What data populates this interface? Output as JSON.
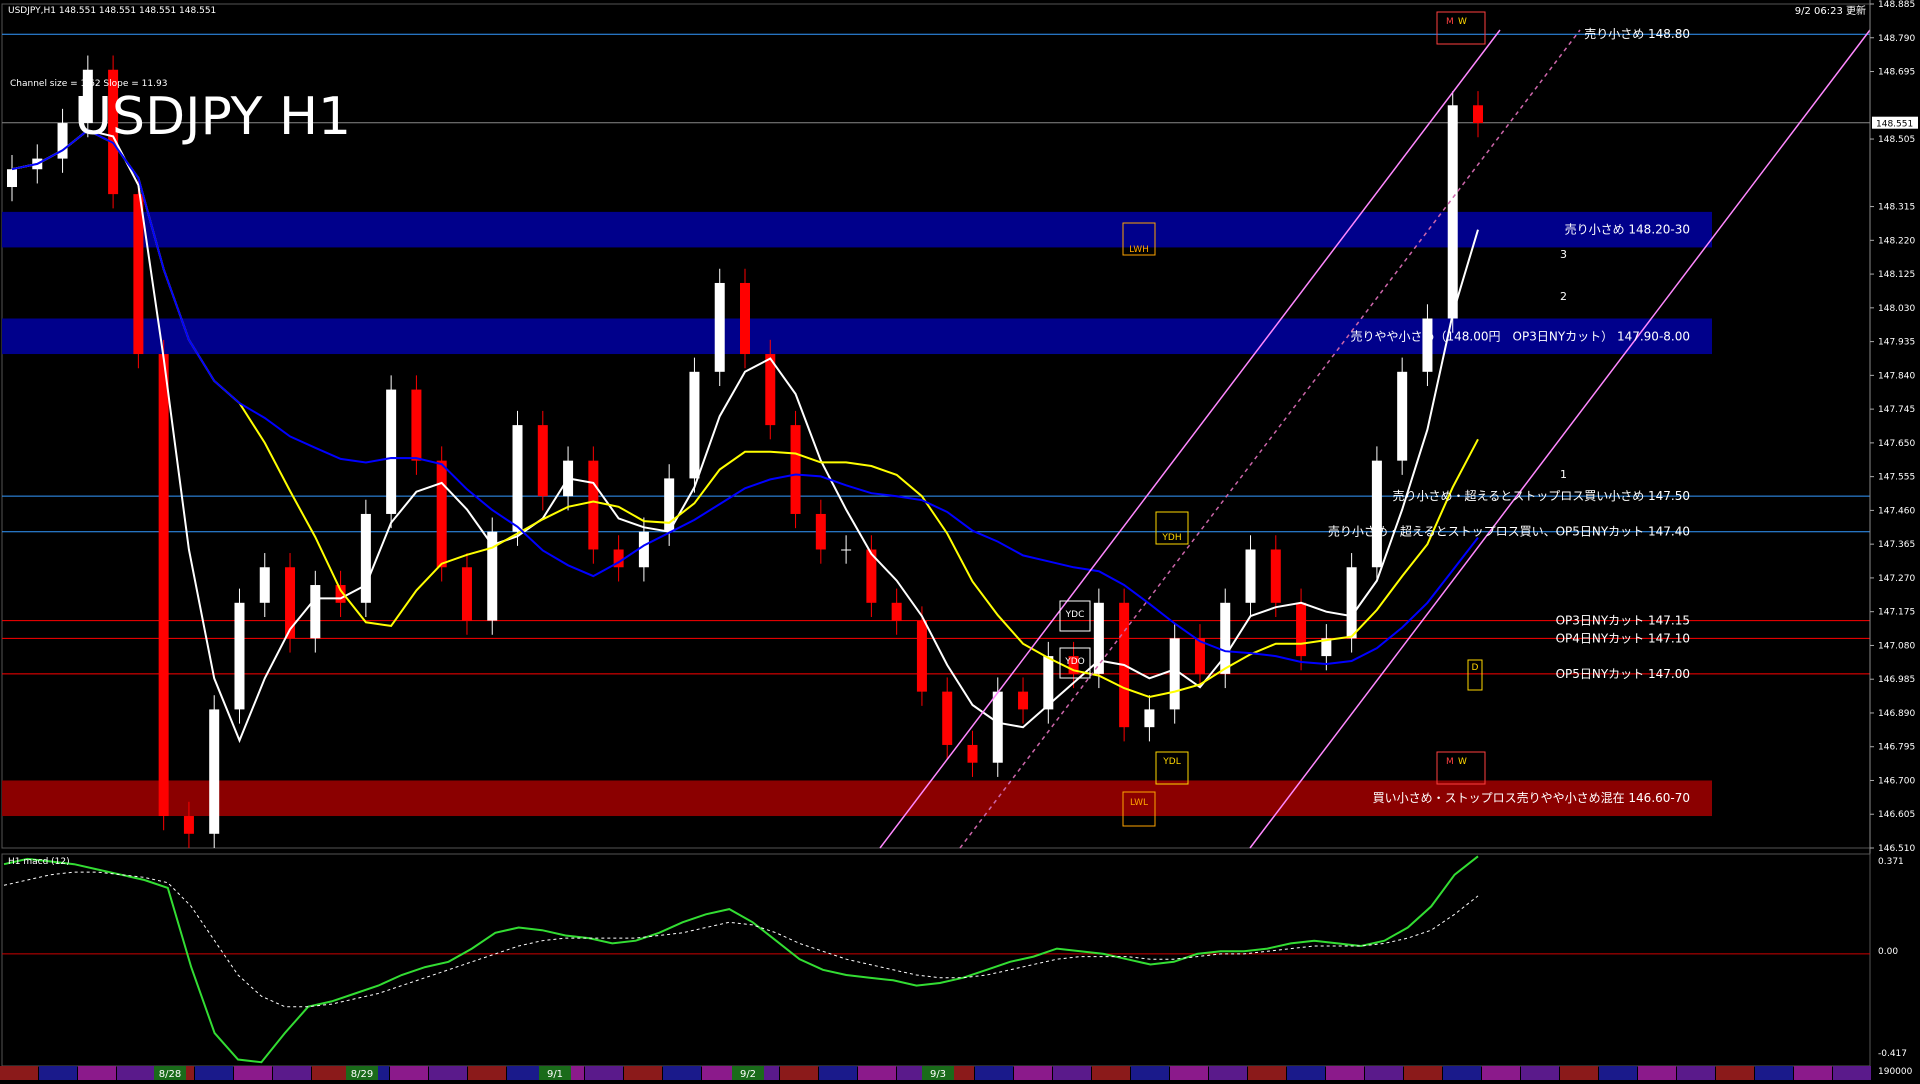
{
  "header": {
    "symbol_line": "USDJPY,H1  148.551 148.551 148.551 148.551",
    "channel_info": "Channel size = 1.62  Slope = 11.93",
    "big_title": "USDJPY H1",
    "datetime": "9/2 06:23 更新"
  },
  "price_axis": {
    "min": 146.51,
    "max": 148.885,
    "ticks": [
      "148.885",
      "148.790",
      "148.695",
      "148.505",
      "148.315",
      "148.220",
      "148.125",
      "148.030",
      "147.935",
      "147.840",
      "147.745",
      "147.650",
      "147.555",
      "147.460",
      "147.365",
      "147.270",
      "147.175",
      "147.080",
      "146.985",
      "146.890",
      "146.795",
      "146.700",
      "146.605",
      "146.510"
    ],
    "current": "148.551"
  },
  "macd": {
    "label": "H1  macd (12)",
    "axis_top": "0.371",
    "axis_zero": "0.00",
    "axis_bottom": "-0.417",
    "axis_footer": "190000",
    "range": [
      -0.417,
      0.371
    ],
    "main": [
      0.34,
      0.36,
      0.35,
      0.34,
      0.32,
      0.3,
      0.28,
      0.25,
      -0.05,
      -0.3,
      -0.4,
      -0.41,
      -0.3,
      -0.2,
      -0.18,
      -0.15,
      -0.12,
      -0.08,
      -0.05,
      -0.03,
      0.02,
      0.08,
      0.1,
      0.09,
      0.07,
      0.06,
      0.04,
      0.05,
      0.08,
      0.12,
      0.15,
      0.17,
      0.12,
      0.05,
      -0.02,
      -0.06,
      -0.08,
      -0.09,
      -0.1,
      -0.12,
      -0.11,
      -0.09,
      -0.06,
      -0.03,
      -0.01,
      0.02,
      0.01,
      0.0,
      -0.02,
      -0.04,
      -0.03,
      0.0,
      0.01,
      0.01,
      0.02,
      0.04,
      0.05,
      0.04,
      0.03,
      0.05,
      0.1,
      0.18,
      0.3,
      0.37
    ],
    "signal": [
      0.26,
      0.28,
      0.3,
      0.31,
      0.31,
      0.3,
      0.29,
      0.27,
      0.18,
      0.05,
      -0.08,
      -0.16,
      -0.2,
      -0.2,
      -0.19,
      -0.17,
      -0.15,
      -0.12,
      -0.09,
      -0.06,
      -0.03,
      0.0,
      0.03,
      0.05,
      0.06,
      0.06,
      0.06,
      0.06,
      0.07,
      0.08,
      0.1,
      0.12,
      0.11,
      0.08,
      0.04,
      0.01,
      -0.02,
      -0.04,
      -0.06,
      -0.08,
      -0.09,
      -0.09,
      -0.08,
      -0.06,
      -0.04,
      -0.02,
      -0.01,
      -0.01,
      -0.01,
      -0.02,
      -0.02,
      -0.01,
      0.0,
      0.0,
      0.01,
      0.02,
      0.03,
      0.03,
      0.03,
      0.04,
      0.06,
      0.09,
      0.15,
      0.22
    ]
  },
  "dates": [
    "8/28",
    "8/29",
    "9/1",
    "9/2",
    "9/3"
  ],
  "zones": [
    {
      "label": "売り小さめ 148.20-30",
      "from": 148.2,
      "to": 148.3,
      "color": "#00008b"
    },
    {
      "label": "売りやや小さめ（148.00円　OP3日NYカット） 147.90-8.00",
      "from": 147.9,
      "to": 148.0,
      "color": "#00008b"
    },
    {
      "label": "買い小さめ・ストップロス売りやや小さめ混在 146.60-70",
      "from": 146.6,
      "to": 146.7,
      "color": "#8b0000"
    }
  ],
  "levels": [
    {
      "label": "売り小さめ 148.80",
      "price": 148.8,
      "color": "#3399ff"
    },
    {
      "label": "売り小さめ・超えるとストップロス買い小さめ 147.50",
      "price": 147.5,
      "color": "#3399ff"
    },
    {
      "label": "売り小さめ・超えるとストップロス買い、OP5日NYカット 147.40",
      "price": 147.4,
      "color": "#3399ff"
    },
    {
      "label": "OP3日NYカット 147.15",
      "price": 147.15,
      "color": "#ff0000"
    },
    {
      "label": "OP4日NYカット 147.10",
      "price": 147.1,
      "color": "#ff0000"
    },
    {
      "label": "OP5日NYカット 147.00",
      "price": 147.0,
      "color": "#ff0000"
    }
  ],
  "boxes": {
    "lwh": "LWH",
    "lwl": "LWL",
    "ydh": "YDH",
    "ydl": "YDL",
    "ydc": "YDC",
    "ydo": "YDO",
    "d": "D",
    "m": "M",
    "w": "W",
    "ch1": "1",
    "ch2": "2",
    "ch3": "3"
  },
  "chart_data": {
    "type": "candlestick",
    "title": "USDJPY H1",
    "ylim": [
      146.51,
      148.885
    ],
    "closes": [
      148.42,
      148.45,
      148.55,
      148.7,
      148.35,
      147.9,
      146.6,
      146.55,
      146.9,
      147.2,
      147.3,
      147.1,
      147.25,
      147.2,
      147.45,
      147.8,
      147.6,
      147.3,
      147.15,
      147.4,
      147.7,
      147.5,
      147.6,
      147.35,
      147.3,
      147.4,
      147.55,
      147.85,
      148.1,
      147.9,
      147.7,
      147.45,
      147.35,
      147.35,
      147.2,
      147.15,
      146.95,
      146.8,
      146.75,
      146.95,
      146.9,
      147.05,
      147.0,
      147.2,
      146.85,
      146.9,
      147.1,
      147.0,
      147.2,
      147.35,
      147.2,
      147.05,
      147.1,
      147.3,
      147.6,
      147.85,
      148.0,
      148.6,
      148.55
    ],
    "colors": {
      "bull": "#ffffff",
      "bear": "#ff0000"
    }
  }
}
